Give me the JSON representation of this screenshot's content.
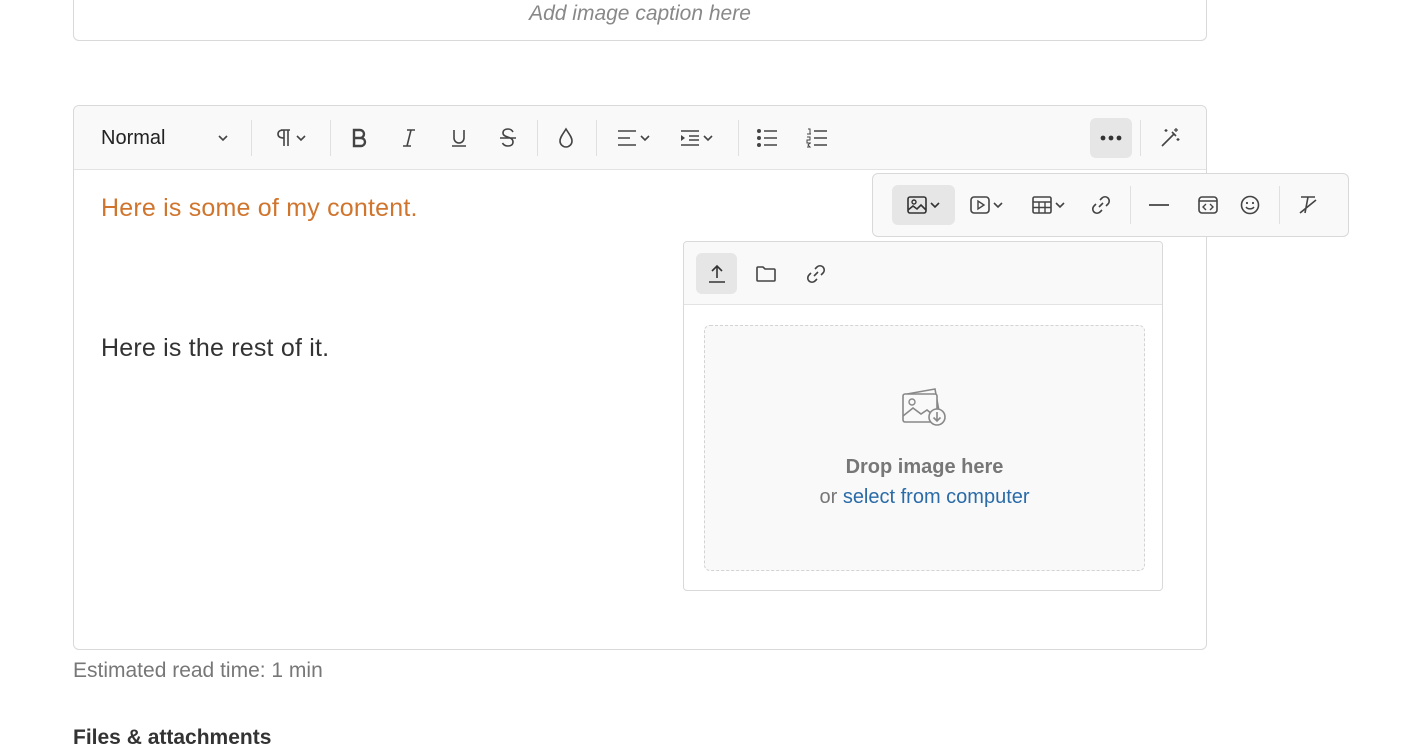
{
  "caption": {
    "placeholder_text": "Add image caption here"
  },
  "toolbar": {
    "format_select_value": "Normal"
  },
  "content": {
    "line1": "Here is some of my content.",
    "line2": "Here is the rest of it.",
    "line1_color": "#d0752e"
  },
  "image_popup": {
    "drop_title": "Drop image here",
    "drop_or": "or",
    "select_link": "select from computer"
  },
  "footer": {
    "read_time": "Estimated read time: 1 min",
    "files_title": "Files & attachments"
  },
  "colors": {
    "link": "#2a6ba8",
    "active_bg": "#e6e6e6",
    "toolbar_bg": "#f9f9f9"
  }
}
